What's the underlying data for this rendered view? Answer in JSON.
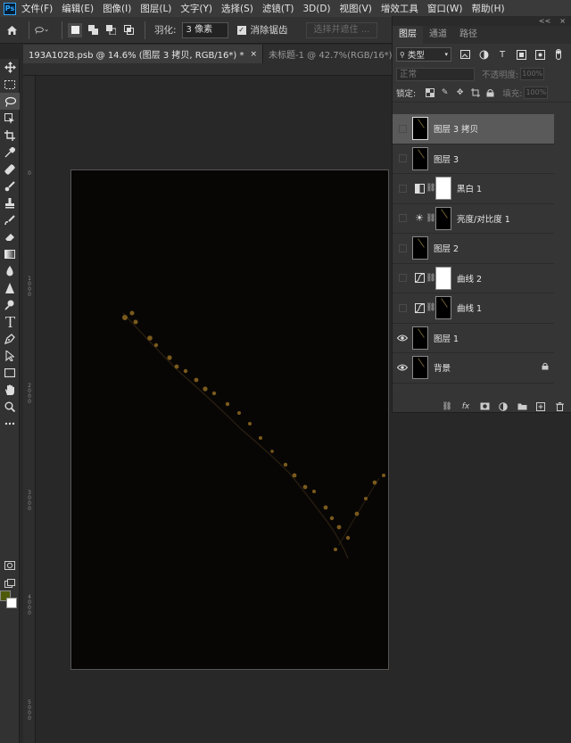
{
  "app": {
    "logo": "Ps"
  },
  "menu": [
    "文件(F)",
    "编辑(E)",
    "图像(I)",
    "图层(L)",
    "文字(Y)",
    "选择(S)",
    "滤镜(T)",
    "3D(D)",
    "视图(V)",
    "增效工具",
    "窗口(W)",
    "帮助(H)"
  ],
  "options": {
    "feather_label": "羽化:",
    "feather_value": "3 像素",
    "antialias_label": "消除锯齿",
    "select_and_mask": "选择并遮住 ..."
  },
  "tabs": [
    {
      "label": "193A1028.psb @ 14.6% (图层 3 拷贝, RGB/16*) *",
      "close": "×"
    },
    {
      "label": "未标题-1 @ 42.7%(RGB/16*) *",
      "close": "×"
    }
  ],
  "colors": {
    "foreground": "#4e5a0a",
    "background": "#ffffff"
  },
  "ruler": {
    "top": [],
    "left": [
      "0",
      "1\n0\n0\n0",
      "2\n0\n0\n0",
      "3\n0\n0\n0",
      "4\n0\n0\n0",
      "5\n0\n0\n0"
    ]
  },
  "layers_panel": {
    "collapse": "<<",
    "close": "×",
    "tabs": [
      "图层",
      "通道",
      "路径"
    ],
    "filter_label": "类型",
    "blend_mode": "正常",
    "opacity_label": "不透明度:",
    "opacity_value": "100%",
    "lock_label": "锁定:",
    "fill_label": "填充:",
    "fill_value": "100%",
    "layers": [
      {
        "name": "图层 3 拷贝",
        "visible": false,
        "selected": true,
        "type": "pixel"
      },
      {
        "name": "图层 3",
        "visible": false,
        "selected": false,
        "type": "pixel"
      },
      {
        "name": "黑白 1",
        "visible": false,
        "selected": false,
        "type": "adjust-bw"
      },
      {
        "name": "亮度/对比度 1",
        "visible": false,
        "selected": false,
        "type": "adjust-brightness"
      },
      {
        "name": "图层 2",
        "visible": false,
        "selected": false,
        "type": "pixel"
      },
      {
        "name": "曲线 2",
        "visible": false,
        "selected": false,
        "type": "adjust-curves-white"
      },
      {
        "name": "曲线 1",
        "visible": false,
        "selected": false,
        "type": "adjust-curves"
      },
      {
        "name": "图层 1",
        "visible": true,
        "selected": false,
        "type": "pixel"
      },
      {
        "name": "背景",
        "visible": true,
        "selected": false,
        "type": "background",
        "locked": true
      }
    ]
  }
}
